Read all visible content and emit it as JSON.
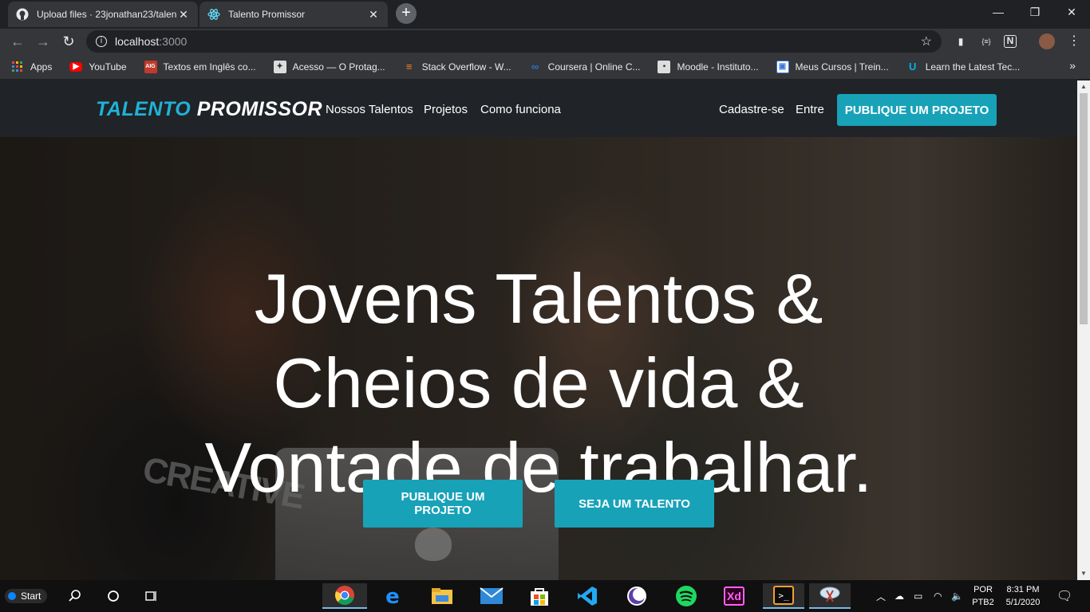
{
  "browser": {
    "tabs": [
      {
        "title": "Upload files · 23jonathan23/talen",
        "favicon": "github-icon"
      },
      {
        "title": "Talento Promissor",
        "favicon": "react-icon"
      }
    ],
    "address": {
      "host": "localhost",
      "port": ":3000"
    },
    "bookmarks": [
      {
        "label": "Apps",
        "icon": "apps-grid-icon",
        "color": "#ea4335"
      },
      {
        "label": "YouTube",
        "icon": "youtube-icon",
        "color": "#ff0000"
      },
      {
        "label": "Textos em Inglês co...",
        "icon": "textos-icon",
        "color": "#c0392b"
      },
      {
        "label": "Acesso — O Protag...",
        "icon": "acesso-icon",
        "color": "#777777"
      },
      {
        "label": "Stack Overflow - W...",
        "icon": "stackoverflow-icon",
        "color": "#f48024"
      },
      {
        "label": "Coursera | Online C...",
        "icon": "coursera-icon",
        "color": "#2a73cc"
      },
      {
        "label": "Moodle - Instituto...",
        "icon": "moodle-icon",
        "color": "#888888"
      },
      {
        "label": "Meus Cursos | Trein...",
        "icon": "cursos-icon",
        "color": "#3a7bd5"
      },
      {
        "label": "Learn the Latest Tec...",
        "icon": "udacity-icon",
        "color": "#02b3e4"
      }
    ],
    "more_bookmarks": "»"
  },
  "site": {
    "brand_part1": "TALENTO",
    "brand_part2": "PROMISSOR",
    "nav": [
      "Nossos Talentos",
      "Projetos",
      "Como funciona"
    ],
    "signup": "Cadastre-se",
    "login": "Entre",
    "cta": "PUBLIQUE UM PROJETO",
    "headline": [
      "Jovens Talentos &",
      "Cheios de vida &",
      "Vontade de trabalhar."
    ],
    "hero_button_1": "PUBLIQUE UM PROJETO",
    "hero_button_2": "SEJA UM TALENTO",
    "hero_image_text": "CREATIVE",
    "colors": {
      "accent": "#17a2b8",
      "brand_blue": "#1fb2d8",
      "navbar": "#202327"
    }
  },
  "taskbar": {
    "start_label": "Start",
    "lang_top": "POR",
    "lang_bottom": "PTB2",
    "time": "8:31 PM",
    "date": "5/1/2020",
    "xd_label": "Xd"
  }
}
